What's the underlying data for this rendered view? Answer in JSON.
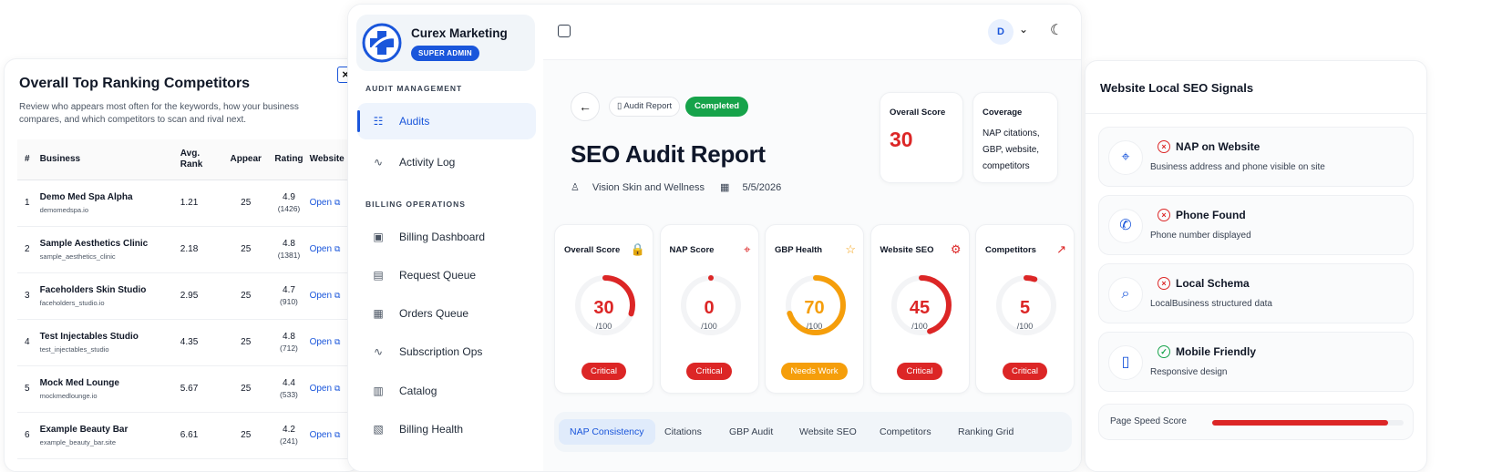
{
  "colors": {
    "accent": "#1a56db",
    "critical": "#dc2626",
    "warning": "#f59e0b",
    "success": "#16a34a"
  },
  "competitors_panel": {
    "title": "Overall Top Ranking Competitors",
    "description": "Review who appears most often for the keywords, how your business compares, and which competitors to scan and rival next.",
    "close_icon": "close-icon",
    "columns": [
      "#",
      "Business",
      "Avg. Rank",
      "Appear",
      "Rating",
      "Website"
    ],
    "rows": [
      {
        "num": "1",
        "name": "Demo Med Spa Alpha",
        "domain": "demomedspa.io",
        "rank": "1.21",
        "appear": "25",
        "rating": "4.9",
        "count": "(1426)",
        "link": "Open"
      },
      {
        "num": "2",
        "name": "Sample Aesthetics Clinic",
        "domain": "sample_aesthetics_clinic",
        "rank": "2.18",
        "appear": "25",
        "rating": "4.8",
        "count": "(1381)",
        "link": "Open"
      },
      {
        "num": "3",
        "name": "Faceholders Skin Studio",
        "domain": "faceholders_studio.io",
        "rank": "2.95",
        "appear": "25",
        "rating": "4.7",
        "count": "(910)",
        "link": "Open"
      },
      {
        "num": "4",
        "name": "Test Injectables Studio",
        "domain": "test_injectables_studio",
        "rank": "4.35",
        "appear": "25",
        "rating": "4.8",
        "count": "(712)",
        "link": "Open"
      },
      {
        "num": "5",
        "name": "Mock Med Lounge",
        "domain": "mockmedlounge.io",
        "rank": "5.67",
        "appear": "25",
        "rating": "4.4",
        "count": "(533)",
        "link": "Open"
      },
      {
        "num": "6",
        "name": "Example Beauty Bar",
        "domain": "example_beauty_bar.site",
        "rank": "6.61",
        "appear": "25",
        "rating": "4.2",
        "count": "(241)",
        "link": "Open"
      }
    ]
  },
  "sidebar": {
    "brand_name": "Curex Marketing",
    "role_badge": "SUPER ADMIN",
    "section_audit": "AUDIT MANAGEMENT",
    "section_billing": "BILLING OPERATIONS",
    "items": [
      {
        "label": "Audits",
        "icon": "audit-icon"
      },
      {
        "label": "Activity Log",
        "icon": "activity-icon"
      },
      {
        "label": "Billing Dashboard",
        "icon": "dashboard-icon"
      },
      {
        "label": "Request Queue",
        "icon": "queue-icon"
      },
      {
        "label": "Orders Queue",
        "icon": "orders-icon"
      },
      {
        "label": "Subscription Ops",
        "icon": "subscription-icon"
      },
      {
        "label": "Catalog",
        "icon": "catalog-icon"
      },
      {
        "label": "Billing Health",
        "icon": "health-icon"
      }
    ]
  },
  "topbar": {
    "avatar_initial": "D"
  },
  "report": {
    "crumb": "Audit Report",
    "status": "Completed",
    "title": "SEO Audit Report",
    "business": "Vision Skin and Wellness",
    "date": "5/5/2026",
    "overall_label": "Overall Score",
    "overall_value": "30",
    "coverage_label": "Coverage",
    "coverage_text": "NAP citations, GBP, website, competitors"
  },
  "score_cards": [
    {
      "title": "Overall Score",
      "value": "30",
      "denom": "/100",
      "status": "Critical",
      "score": 30,
      "color": "#dc2626",
      "icon": "lock-icon"
    },
    {
      "title": "NAP Score",
      "value": "0",
      "denom": "/100",
      "status": "Critical",
      "score": 0,
      "color": "#dc2626",
      "icon": "pin-icon"
    },
    {
      "title": "GBP Health",
      "value": "70",
      "denom": "/100",
      "status": "Needs Work",
      "score": 70,
      "color": "#f59e0b",
      "icon": "star-icon"
    },
    {
      "title": "Website SEO",
      "value": "45",
      "denom": "/100",
      "status": "Critical",
      "score": 45,
      "color": "#dc2626",
      "icon": "gear-icon"
    },
    {
      "title": "Competitors",
      "value": "5",
      "denom": "/100",
      "status": "Critical",
      "score": 5,
      "color": "#dc2626",
      "icon": "trend-icon"
    }
  ],
  "tabs": [
    "NAP Consistency",
    "Citations",
    "GBP Audit",
    "Website SEO",
    "Competitors",
    "Ranking Grid"
  ],
  "signals_panel": {
    "title": "Website Local SEO Signals",
    "signals": [
      {
        "title": "NAP on Website",
        "desc": "Business address and phone visible on site",
        "icon": "pin-icon",
        "status": "fail"
      },
      {
        "title": "Phone Found",
        "desc": "Phone number displayed",
        "icon": "phone-icon",
        "status": "fail"
      },
      {
        "title": "Local Schema",
        "desc": "LocalBusiness structured data",
        "icon": "search-icon",
        "status": "fail"
      },
      {
        "title": "Mobile Friendly",
        "desc": "Responsive design",
        "icon": "mobile-icon",
        "status": "pass"
      }
    ],
    "speed_label": "Page Speed Score",
    "speed_fraction": 0.92
  }
}
